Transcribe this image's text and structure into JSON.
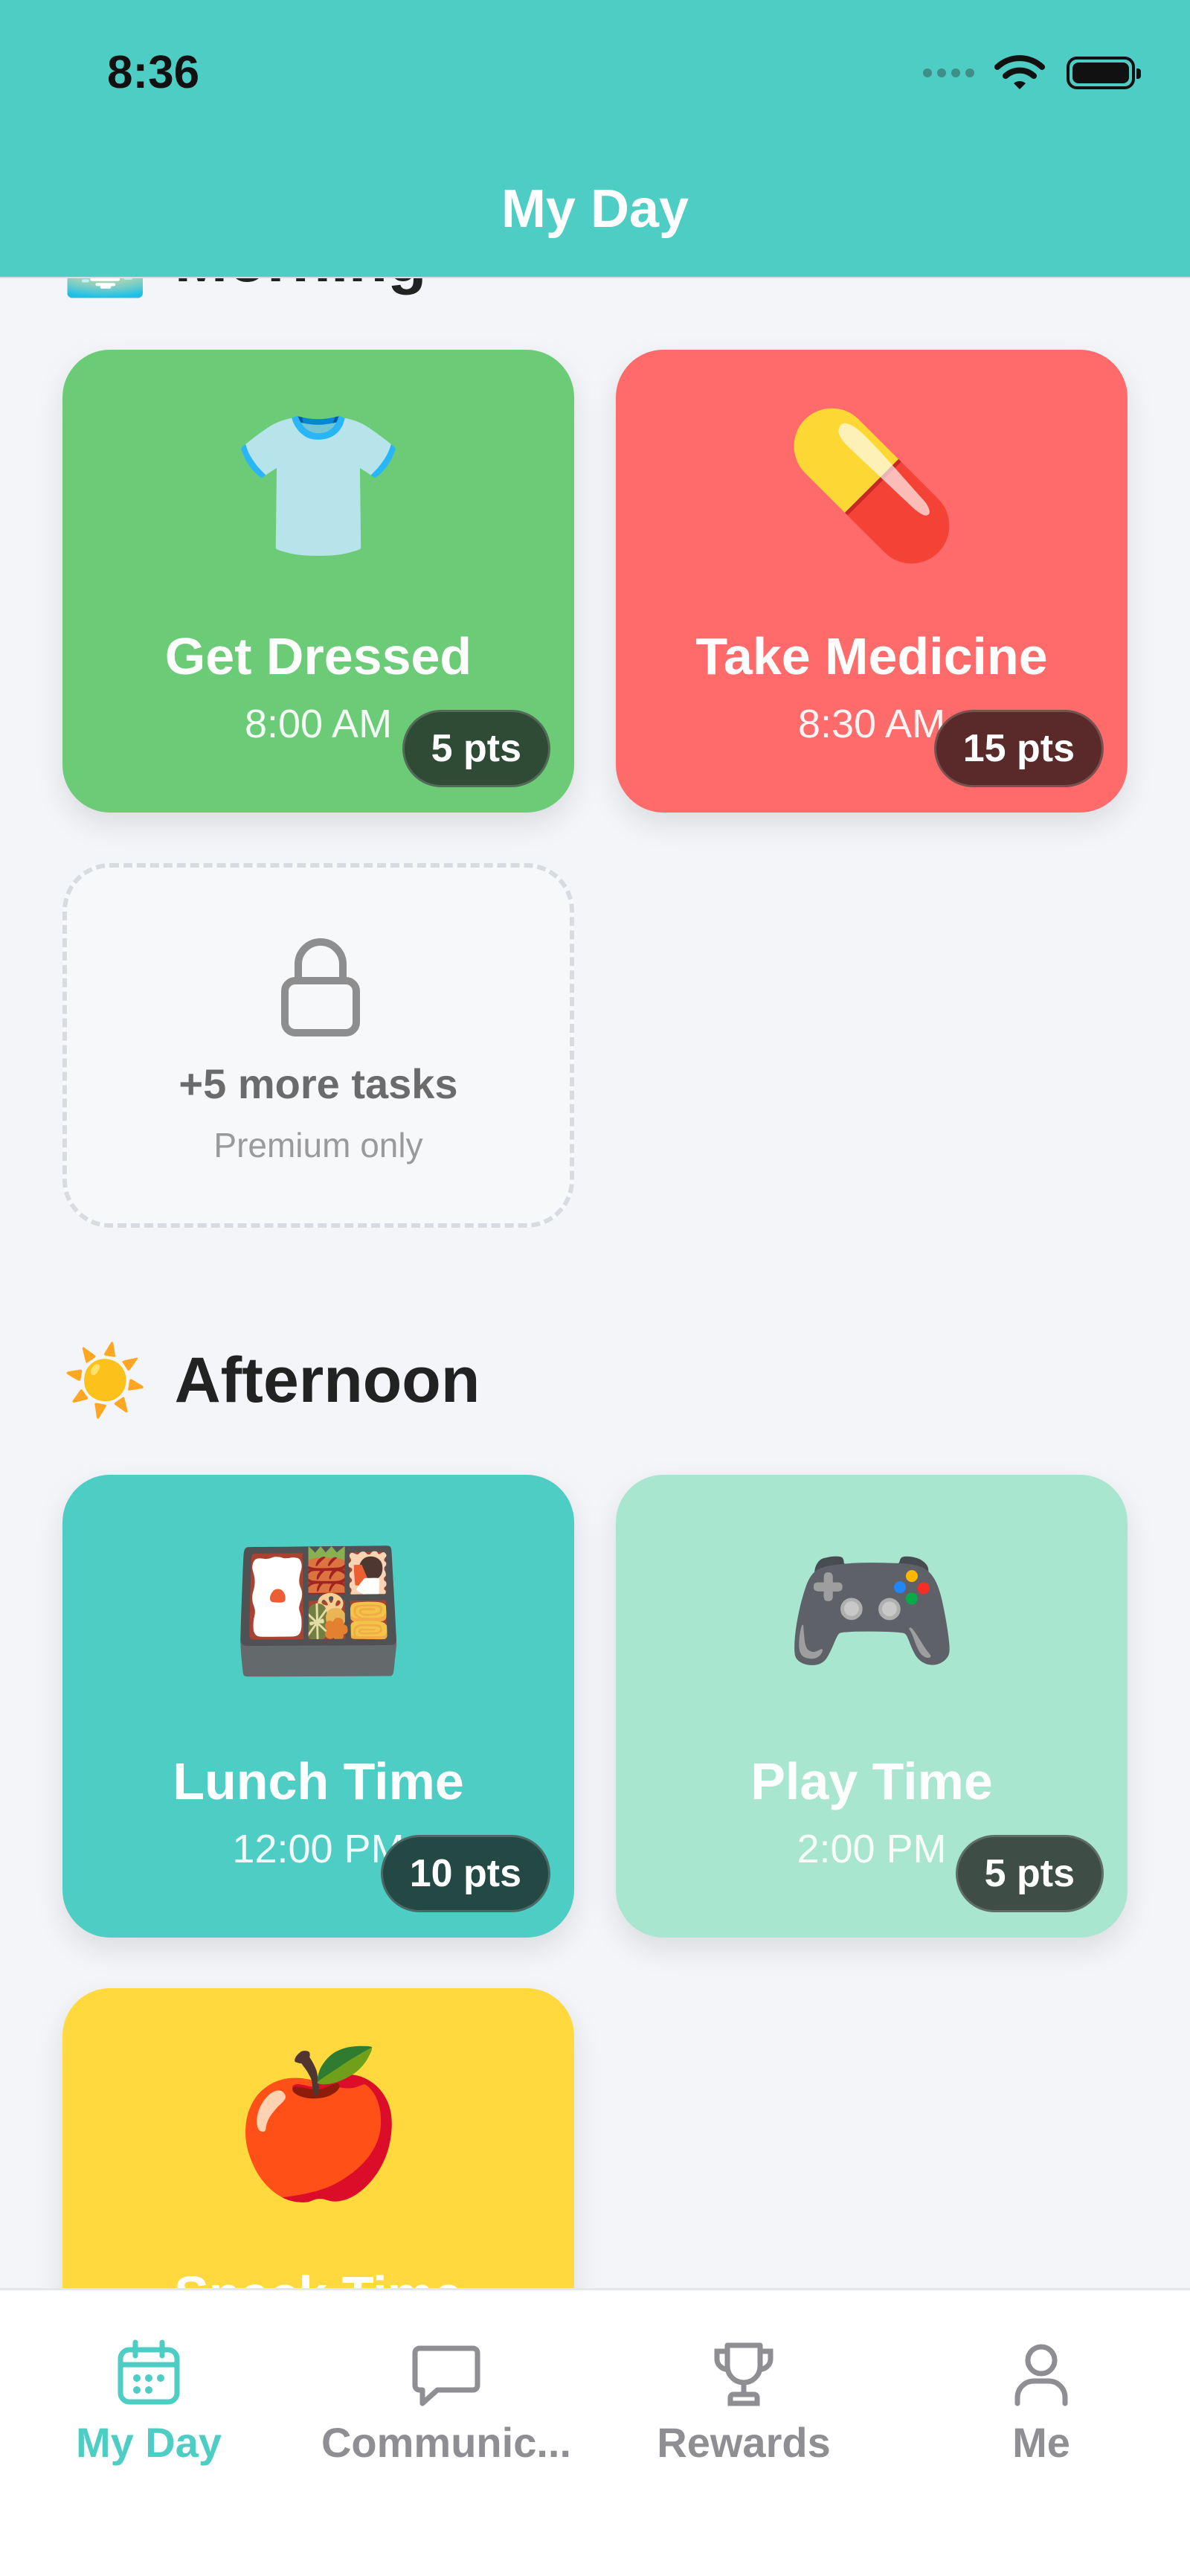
{
  "status_bar": {
    "time": "8:36"
  },
  "nav": {
    "title": "My Day"
  },
  "sections": {
    "morning": {
      "label": "Morning",
      "emoji": "🌅"
    },
    "afternoon": {
      "label": "Afternoon",
      "emoji": "☀️"
    }
  },
  "tasks": [
    {
      "title": "Get Dressed",
      "time": "8:00 AM",
      "points": "5 pts",
      "icon": "👕",
      "color": "#6BCB77",
      "badge_color": "#2F4A35"
    },
    {
      "title": "Take Medicine",
      "time": "8:30 AM",
      "points": "15 pts",
      "icon": "💊",
      "color": "#FF6B6B",
      "badge_color": "#5A2A2A"
    },
    {
      "title": "Lunch Time",
      "time": "12:00 PM",
      "points": "10 pts",
      "icon": "🍱",
      "color": "#4ECDC4",
      "badge_color": "#244844"
    },
    {
      "title": "Play Time",
      "time": "2:00 PM",
      "points": "5 pts",
      "icon": "🎮",
      "color": "#A8E6CF",
      "badge_color": "#3E4D46"
    },
    {
      "title": "Snack Time",
      "time": "",
      "points": "",
      "icon": "🍎",
      "color": "#FFD93D",
      "badge_color": "#4A4320"
    }
  ],
  "locked": {
    "title": "+5 more tasks",
    "subtitle": "Premium only",
    "icon": "lock-icon"
  },
  "tabbar": {
    "items": [
      {
        "label": "My Day",
        "icon": "calendar-icon",
        "active": true
      },
      {
        "label": "Communic...",
        "icon": "chat-bubble-icon",
        "active": false
      },
      {
        "label": "Rewards",
        "icon": "trophy-icon",
        "active": false
      },
      {
        "label": "Me",
        "icon": "person-icon",
        "active": false
      }
    ],
    "active_color": "#4ECDC4",
    "inactive_color": "#8E8E93"
  }
}
